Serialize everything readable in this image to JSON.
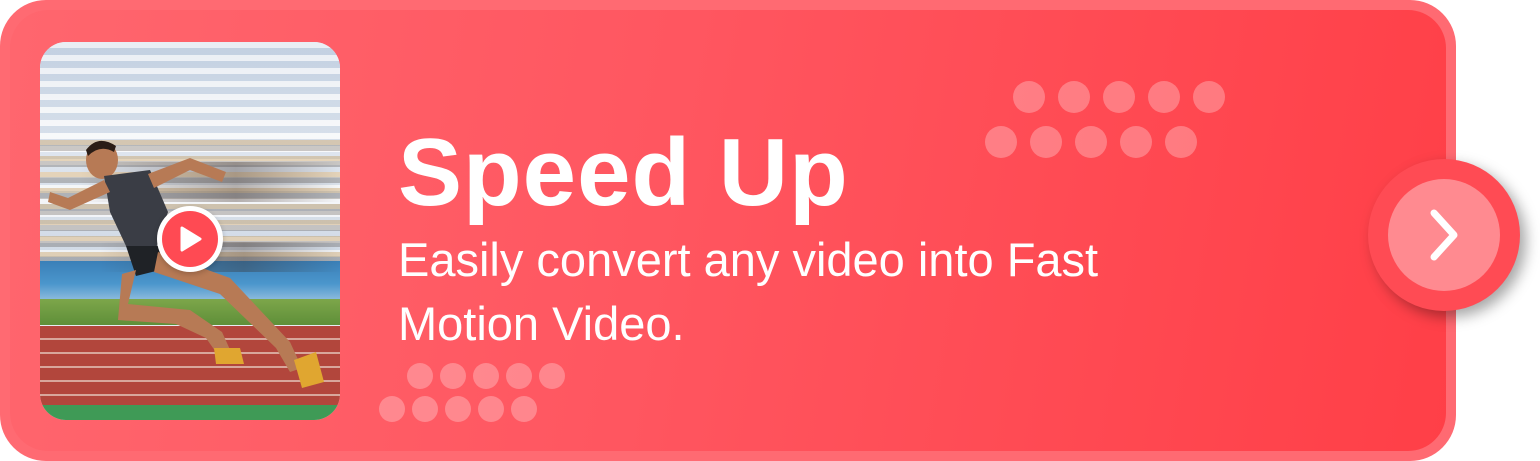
{
  "card": {
    "title": "Speed Up",
    "description": "Easily convert any video into Fast Motion Video.",
    "thumbnail_icon": "play-icon",
    "action_icon": "chevron-right-icon"
  },
  "colors": {
    "card_background": "#ff5660",
    "card_border": "#ff6a72",
    "text": "#ffffff",
    "action_button": "#ff4b54",
    "action_button_inner": "#ff8a90",
    "play_button": "#ff4a53"
  }
}
